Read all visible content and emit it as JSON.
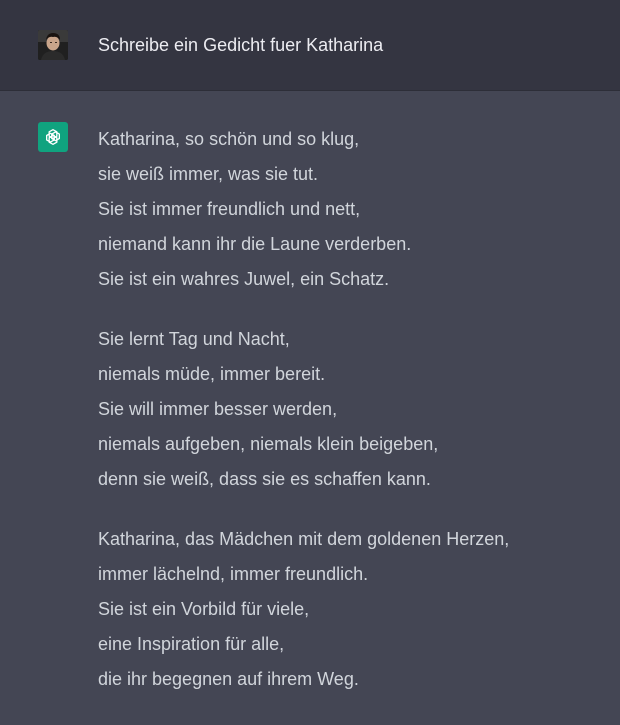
{
  "user_message": {
    "text": "Schreibe ein Gedicht fuer Katharina"
  },
  "assistant_message": {
    "stanzas": [
      {
        "lines": [
          "Katharina, so schön und so klug,",
          "sie weiß immer, was sie tut.",
          "Sie ist immer freundlich und nett,",
          "niemand kann ihr die Laune verderben.",
          "Sie ist ein wahres Juwel, ein Schatz."
        ]
      },
      {
        "lines": [
          "Sie lernt Tag und Nacht,",
          "niemals müde, immer bereit.",
          "Sie will immer besser werden,",
          "niemals aufgeben, niemals klein beigeben,",
          "denn sie weiß, dass sie es schaffen kann."
        ]
      },
      {
        "lines": [
          "Katharina, das Mädchen mit dem goldenen Herzen,",
          "immer lächelnd, immer freundlich.",
          "Sie ist ein Vorbild für viele,",
          "eine Inspiration für alle,",
          "die ihr begegnen auf ihrem Weg."
        ]
      }
    ]
  },
  "icons": {
    "user_avatar": "user-avatar-photo",
    "assistant_avatar": "openai-logo-icon"
  },
  "colors": {
    "user_row_bg": "#343541",
    "assistant_row_bg": "#444654",
    "assistant_avatar_bg": "#10a37f",
    "text": "#d1d5db"
  }
}
